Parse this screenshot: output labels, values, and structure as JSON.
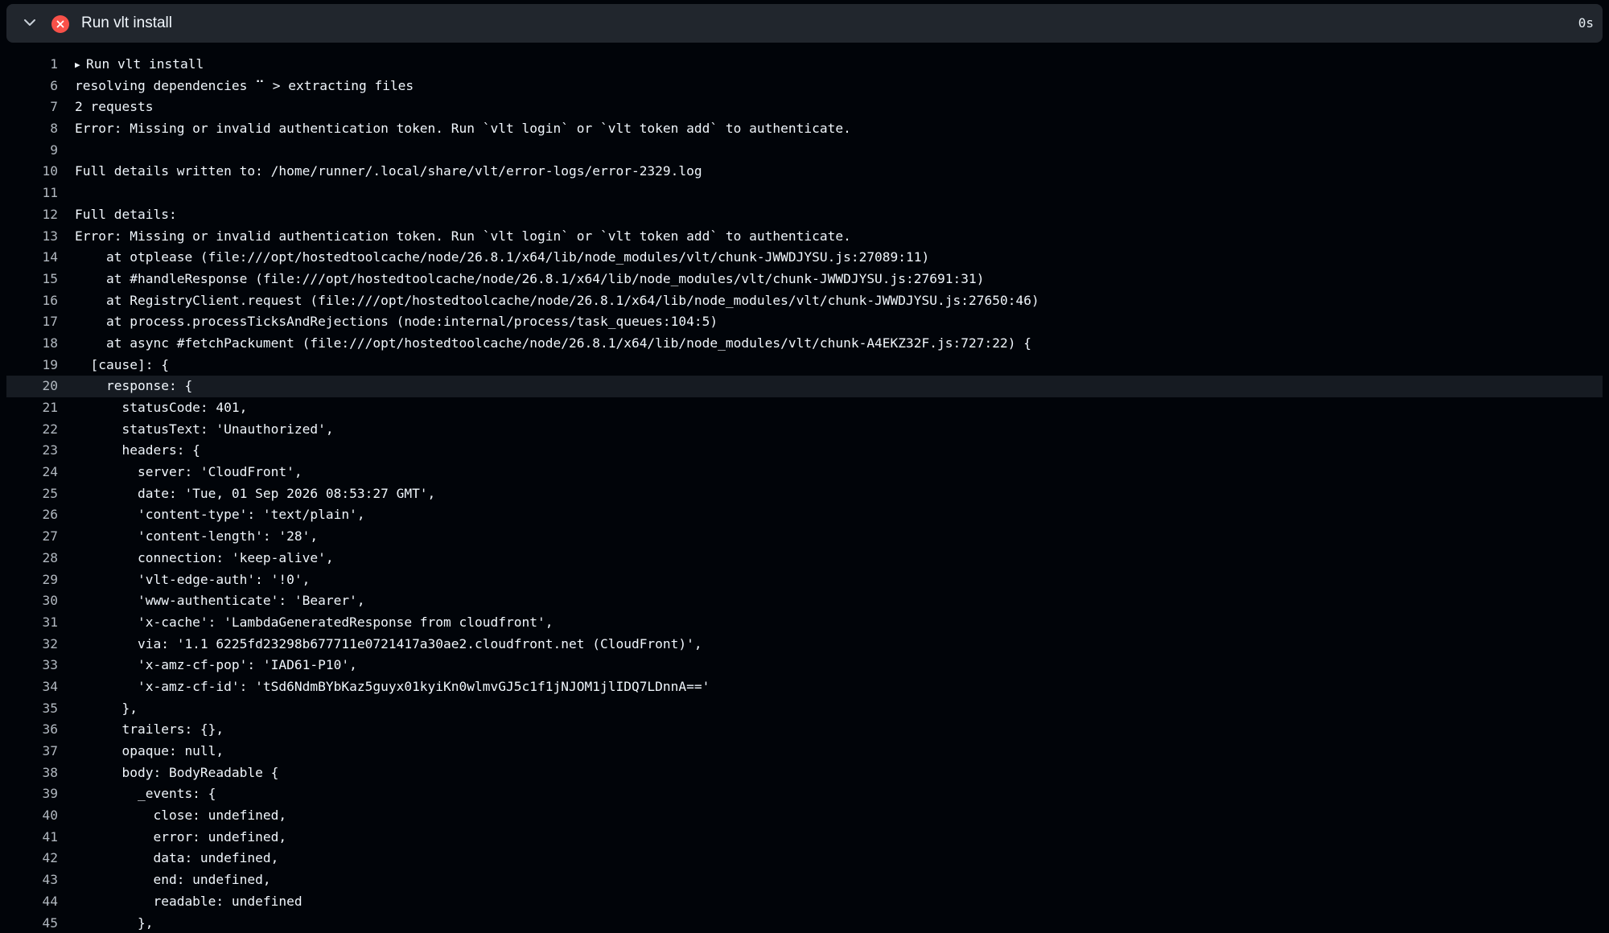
{
  "step": {
    "title": "Run vlt install",
    "duration": "0s",
    "status": "failed",
    "status_color": "#f85149",
    "expand_icon": "chevron-down-icon",
    "status_icon": "x-circle-icon"
  },
  "log": {
    "highlighted_line": "20",
    "lines": [
      {
        "num": "1",
        "text": "Run vlt install",
        "group": true
      },
      {
        "num": "6",
        "text": "resolving dependencies ⠉ > extracting files"
      },
      {
        "num": "7",
        "text": "2 requests"
      },
      {
        "num": "8",
        "text": "Error: Missing or invalid authentication token. Run `vlt login` or `vlt token add` to authenticate."
      },
      {
        "num": "9",
        "text": ""
      },
      {
        "num": "10",
        "text": "Full details written to: /home/runner/.local/share/vlt/error-logs/error-2329.log"
      },
      {
        "num": "11",
        "text": ""
      },
      {
        "num": "12",
        "text": "Full details:"
      },
      {
        "num": "13",
        "text": "Error: Missing or invalid authentication token. Run `vlt login` or `vlt token add` to authenticate."
      },
      {
        "num": "14",
        "text": "    at otplease (file:///opt/hostedtoolcache/node/26.8.1/x64/lib/node_modules/vlt/chunk-JWWDJYSU.js:27089:11)"
      },
      {
        "num": "15",
        "text": "    at #handleResponse (file:///opt/hostedtoolcache/node/26.8.1/x64/lib/node_modules/vlt/chunk-JWWDJYSU.js:27691:31)"
      },
      {
        "num": "16",
        "text": "    at RegistryClient.request (file:///opt/hostedtoolcache/node/26.8.1/x64/lib/node_modules/vlt/chunk-JWWDJYSU.js:27650:46)"
      },
      {
        "num": "17",
        "text": "    at process.processTicksAndRejections (node:internal/process/task_queues:104:5)"
      },
      {
        "num": "18",
        "text": "    at async #fetchPackument (file:///opt/hostedtoolcache/node/26.8.1/x64/lib/node_modules/vlt/chunk-A4EKZ32F.js:727:22) {"
      },
      {
        "num": "19",
        "text": "  [cause]: {"
      },
      {
        "num": "20",
        "text": "    response: {"
      },
      {
        "num": "21",
        "text": "      statusCode: 401,"
      },
      {
        "num": "22",
        "text": "      statusText: 'Unauthorized',"
      },
      {
        "num": "23",
        "text": "      headers: {"
      },
      {
        "num": "24",
        "text": "        server: 'CloudFront',"
      },
      {
        "num": "25",
        "text": "        date: 'Tue, 01 Sep 2026 08:53:27 GMT',"
      },
      {
        "num": "26",
        "text": "        'content-type': 'text/plain',"
      },
      {
        "num": "27",
        "text": "        'content-length': '28',"
      },
      {
        "num": "28",
        "text": "        connection: 'keep-alive',"
      },
      {
        "num": "29",
        "text": "        'vlt-edge-auth': '!0',"
      },
      {
        "num": "30",
        "text": "        'www-authenticate': 'Bearer',"
      },
      {
        "num": "31",
        "text": "        'x-cache': 'LambdaGeneratedResponse from cloudfront',"
      },
      {
        "num": "32",
        "text": "        via: '1.1 6225fd23298b677711e0721417a30ae2.cloudfront.net (CloudFront)',"
      },
      {
        "num": "33",
        "text": "        'x-amz-cf-pop': 'IAD61-P10',"
      },
      {
        "num": "34",
        "text": "        'x-amz-cf-id': 'tSd6NdmBYbKaz5guyx01kyiKn0wlmvGJ5c1f1jNJOM1jlIDQ7LDnnA=='"
      },
      {
        "num": "35",
        "text": "      },"
      },
      {
        "num": "36",
        "text": "      trailers: {},"
      },
      {
        "num": "37",
        "text": "      opaque: null,"
      },
      {
        "num": "38",
        "text": "      body: BodyReadable {"
      },
      {
        "num": "39",
        "text": "        _events: {"
      },
      {
        "num": "40",
        "text": "          close: undefined,"
      },
      {
        "num": "41",
        "text": "          error: undefined,"
      },
      {
        "num": "42",
        "text": "          data: undefined,"
      },
      {
        "num": "43",
        "text": "          end: undefined,"
      },
      {
        "num": "44",
        "text": "          readable: undefined"
      },
      {
        "num": "45",
        "text": "        },"
      }
    ]
  }
}
